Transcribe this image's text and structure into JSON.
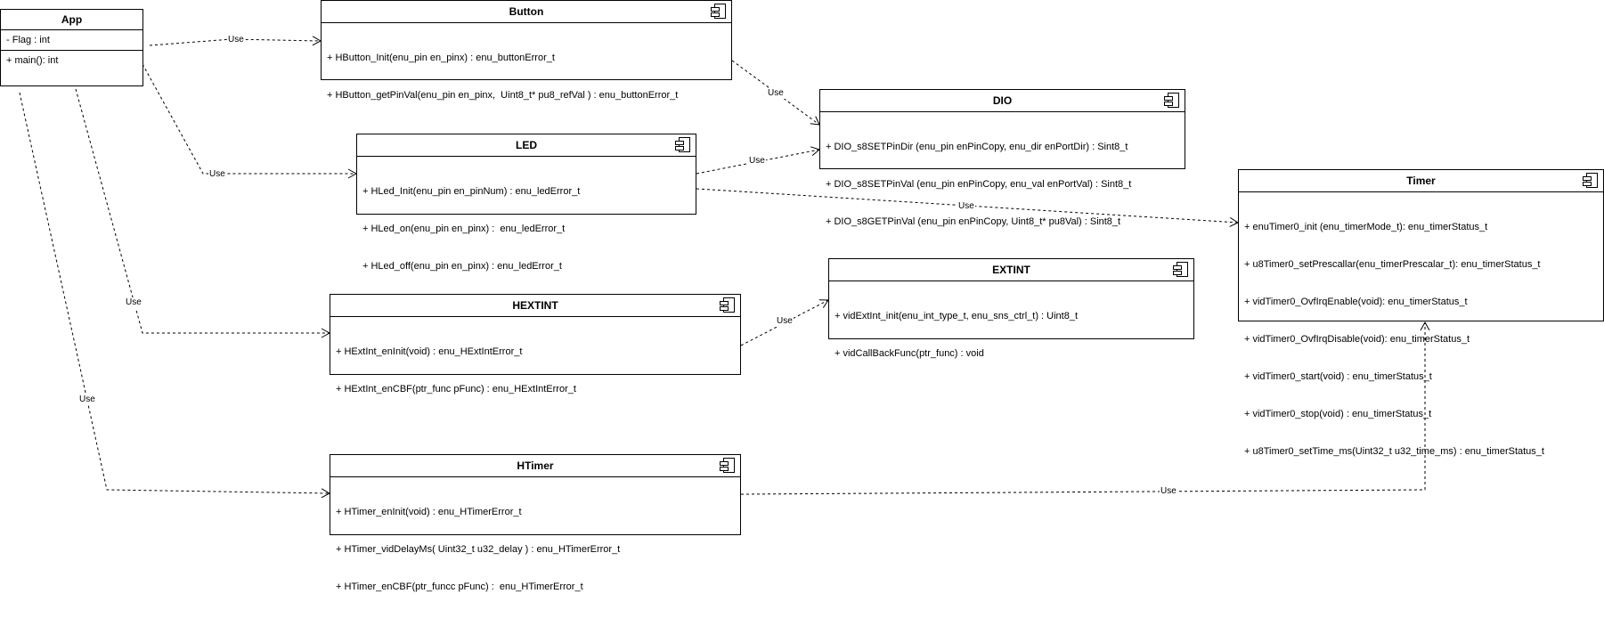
{
  "connector_label": "Use",
  "app": {
    "title": "App",
    "attribute": "- Flag : int",
    "operation": "+ main(): int"
  },
  "button": {
    "title": "Button",
    "ops": [
      "+ HButton_Init(enu_pin en_pinx) : enu_buttonError_t",
      "+ HButton_getPinVal(enu_pin en_pinx,  Uint8_t* pu8_refVal ) : enu_buttonError_t"
    ]
  },
  "led": {
    "title": "LED",
    "ops": [
      "+ HLed_Init(enu_pin en_pinNum) : enu_ledError_t",
      "+ HLed_on(enu_pin en_pinx) :  enu_ledError_t",
      "+ HLed_off(enu_pin en_pinx) : enu_ledError_t"
    ]
  },
  "dio": {
    "title": "DIO",
    "ops": [
      "+ DIO_s8SETPinDir (enu_pin enPinCopy, enu_dir enPortDir) : Sint8_t",
      "+ DIO_s8SETPinVal (enu_pin enPinCopy, enu_val enPortVal) : Sint8_t",
      "+ DIO_s8GETPinVal (enu_pin enPinCopy, Uint8_t* pu8Val) : Sint8_t"
    ]
  },
  "timer": {
    "title": "Timer",
    "ops": [
      "+ enuTimer0_init (enu_timerMode_t): enu_timerStatus_t",
      "+ u8Timer0_setPrescallar(enu_timerPrescalar_t): enu_timerStatus_t",
      "+ vidTimer0_OvfIrqEnable(void): enu_timerStatus_t",
      "+ vidTimer0_OvfIrqDisable(void): enu_timerStatus_t",
      "+ vidTimer0_start(void) : enu_timerStatus_t",
      "+ vidTimer0_stop(void) : enu_timerStatus_t",
      "+ u8Timer0_setTime_ms(Uint32_t u32_time_ms) : enu_timerStatus_t"
    ]
  },
  "extint": {
    "title": "EXTINT",
    "ops": [
      "+ vidExtInt_init(enu_int_type_t, enu_sns_ctrl_t) : Uint8_t",
      "+ vidCallBackFunc(ptr_func) : void"
    ]
  },
  "hextint": {
    "title": "HEXTINT",
    "ops": [
      "+ HExtInt_enInit(void) : enu_HExtIntError_t",
      "+ HExtInt_enCBF(ptr_func pFunc) : enu_HExtIntError_t"
    ]
  },
  "htimer": {
    "title": "HTimer",
    "ops": [
      "+ HTimer_enInit(void) : enu_HTimerError_t",
      "+ HTimer_vidDelayMs( Uint32_t u32_delay ) : enu_HTimerError_t",
      "+ HTimer_enCBF(ptr_funcc pFunc) :  enu_HTimerError_t"
    ]
  }
}
